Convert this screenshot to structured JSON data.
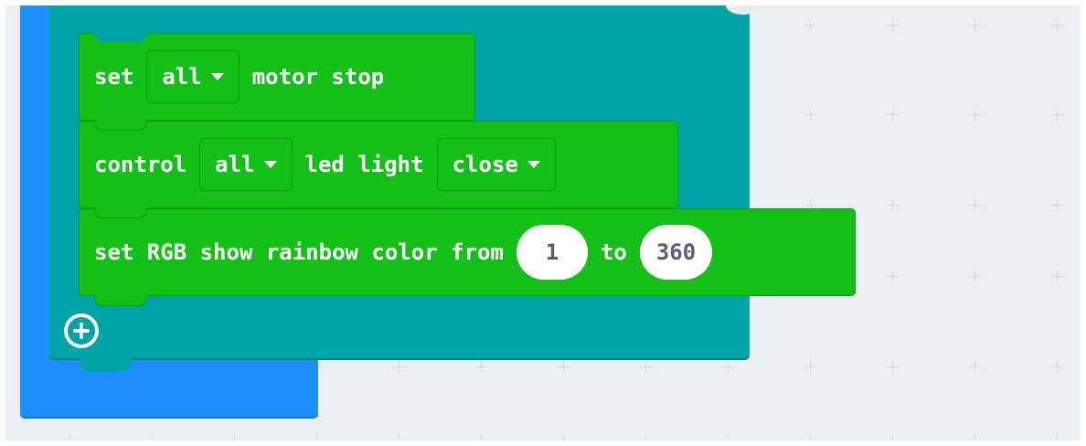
{
  "blocks": {
    "motor_stop": {
      "label_before": "set",
      "motor_option": "all",
      "label_after": "motor stop"
    },
    "led_control": {
      "label_before": "control",
      "led_option": "all",
      "label_middle": "led light",
      "state_option": "close"
    },
    "rgb_rainbow": {
      "label_before": "set RGB show rainbow color from",
      "from_value": "1",
      "label_middle": "to",
      "to_value": "360"
    }
  },
  "loop": {
    "add_icon": "plus-circle-icon"
  },
  "colors": {
    "workspace_bg": "#eceff1",
    "outer_block": "#1e90ff",
    "loop_block": "#00a4a6",
    "statement_block": "#14bf18"
  }
}
